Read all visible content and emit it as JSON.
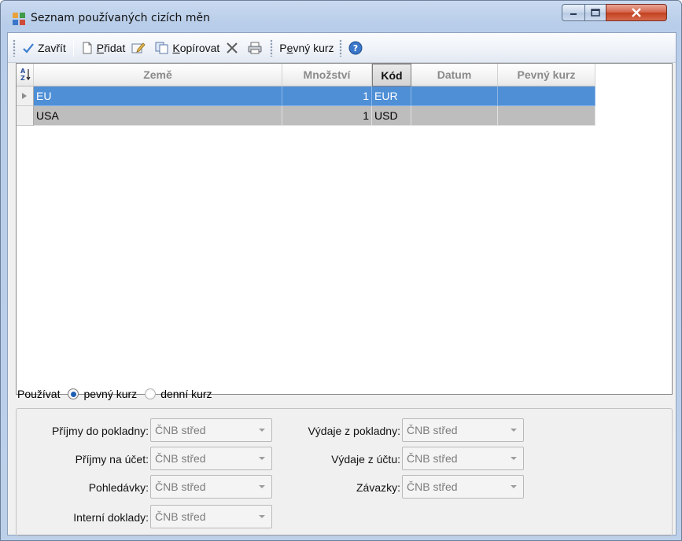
{
  "window": {
    "title": "Seznam používaných cizích měn"
  },
  "toolbar": {
    "close_label": "Zavřít",
    "add_label_prefix": "",
    "add_label_underline": "P",
    "add_label_rest": "řidat",
    "copy_label_underline": "K",
    "copy_label_rest": "opírovat",
    "fixed_rate_prefix": "P",
    "fixed_rate_underline": "e",
    "fixed_rate_rest": "vný kurz"
  },
  "grid": {
    "columns": [
      "Země",
      "Množství",
      "Kód",
      "Datum",
      "Pevný kurz"
    ],
    "sorted_column": "Kód",
    "rows": [
      {
        "country": "EU",
        "amount": "1",
        "code": "EUR",
        "date": "",
        "fixed_rate": ""
      },
      {
        "country": "USA",
        "amount": "1",
        "code": "USD",
        "date": "",
        "fixed_rate": ""
      }
    ]
  },
  "options": {
    "use_label": "Používat",
    "fixed_label": "pevný kurz",
    "daily_label": "denní kurz",
    "selected": "pevný kurz"
  },
  "rates": {
    "income_cash_label": "Příjmy do pokladny:",
    "income_cash_value": "ČNB střed",
    "income_account_label": "Příjmy na účet:",
    "income_account_value": "ČNB střed",
    "receivables_label": "Pohledávky:",
    "receivables_value": "ČNB střed",
    "internal_label": "Interní doklady:",
    "internal_value": "ČNB střed",
    "expense_cash_label": "Výdaje z pokladny:",
    "expense_cash_value": "ČNB střed",
    "expense_account_label": "Výdaje z účtu:",
    "expense_account_value": "ČNB střed",
    "liabilities_label": "Závazky:",
    "liabilities_value": "ČNB střed"
  }
}
